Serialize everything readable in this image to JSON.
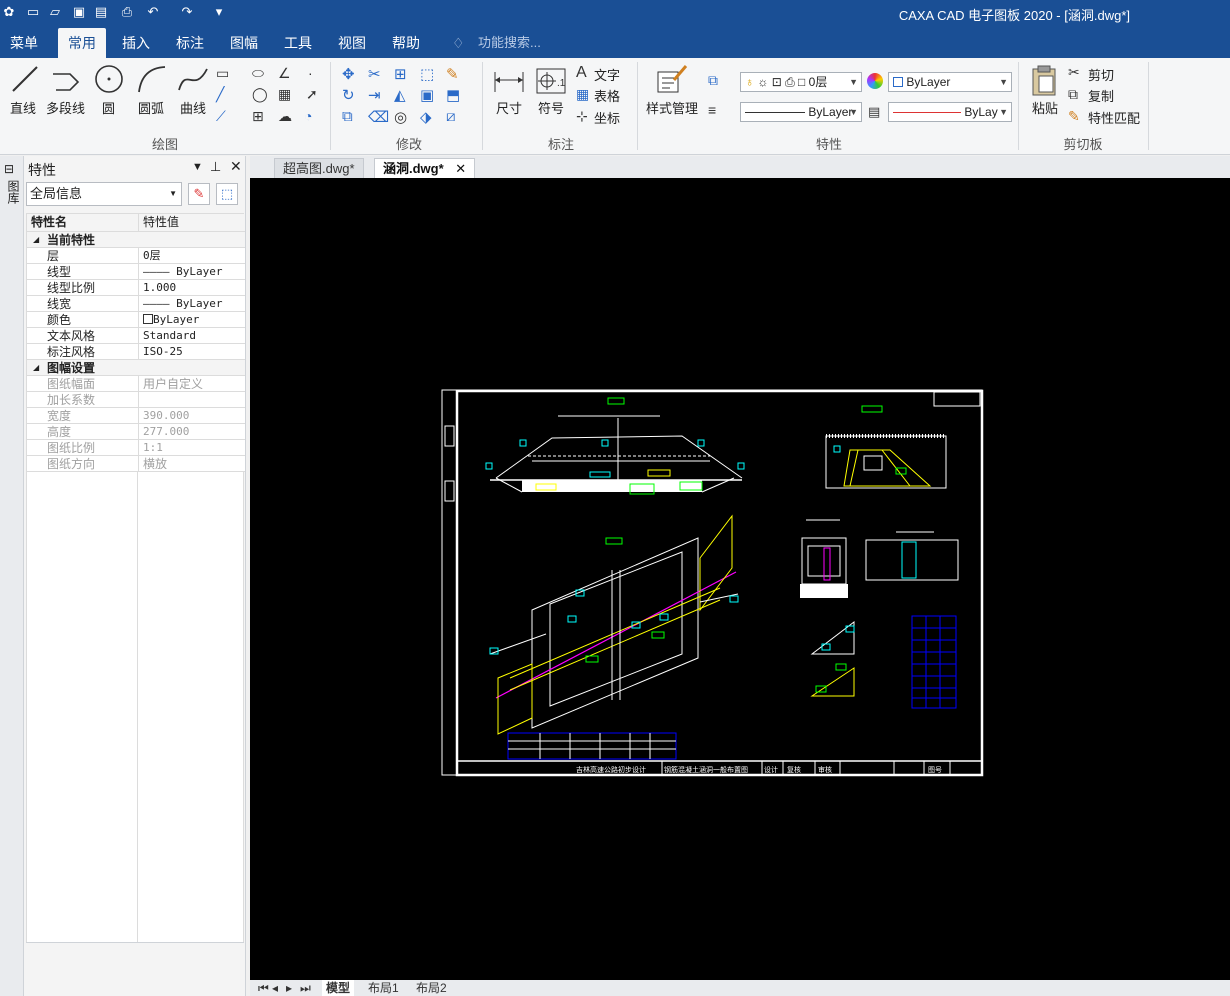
{
  "app_title": "CAXA CAD 电子图板 2020 - [涵洞.dwg*]",
  "quick_access": [
    "app-logo-icon",
    "new-icon",
    "open-icon",
    "save-icon",
    "save-all-icon",
    "print-icon",
    "undo-icon",
    "redo-icon",
    "customize-icon"
  ],
  "menubar": {
    "tabs": [
      "菜单",
      "常用",
      "插入",
      "标注",
      "图幅",
      "工具",
      "视图",
      "帮助"
    ],
    "active": "常用",
    "search_placeholder": "功能搜索..."
  },
  "ribbon": {
    "draw": {
      "line": "直线",
      "polyline": "多段线",
      "circle": "圆",
      "arc": "圆弧",
      "curve": "曲线",
      "group": "绘图"
    },
    "modify": {
      "group": "修改"
    },
    "annotate": {
      "dimension": "尺寸",
      "symbol": "符号",
      "text": "文字",
      "table": "表格",
      "coordinate": "坐标",
      "group": "标注"
    },
    "properties": {
      "style_manage": "样式管理",
      "layer": "0层",
      "color_value": "ByLayer",
      "linetype_value": "ByLayer",
      "lineweight_value": "ByLay",
      "group": "特性"
    },
    "clipboard": {
      "paste": "粘贴",
      "cut": "剪切",
      "copy": "复制",
      "match": "特性匹配",
      "group": "剪切板"
    }
  },
  "left_strip": {
    "label": "图库"
  },
  "panel": {
    "title": "特性",
    "selector": "全局信息",
    "col_name": "特性名",
    "col_value": "特性值",
    "sections": [
      {
        "title": "当前特性",
        "rows": [
          {
            "name": "层",
            "value": "0层"
          },
          {
            "name": "线型",
            "value": "———— ByLayer"
          },
          {
            "name": "线型比例",
            "value": "1.000"
          },
          {
            "name": "线宽",
            "value": "———— ByLayer"
          },
          {
            "name": "颜色",
            "value": "ByLayer"
          },
          {
            "name": "文本风格",
            "value": "Standard"
          },
          {
            "name": "标注风格",
            "value": "ISO-25"
          }
        ]
      },
      {
        "title": "图幅设置",
        "rows": [
          {
            "name": "图纸幅面",
            "value": "用户自定义"
          },
          {
            "name": "加长系数",
            "value": ""
          },
          {
            "name": "宽度",
            "value": "390.000"
          },
          {
            "name": "高度",
            "value": "277.000"
          },
          {
            "name": "图纸比例",
            "value": "1:1"
          },
          {
            "name": "图纸方向",
            "value": "横放"
          }
        ]
      }
    ]
  },
  "doc_tabs": [
    {
      "label": "超高图.dwg*",
      "active": false
    },
    {
      "label": "涵洞.dwg*",
      "active": true
    }
  ],
  "layout_tabs": [
    "模型",
    "布局1",
    "布局2"
  ],
  "active_layout": "模型",
  "drawing": {
    "title_block": [
      "吉林高速公路初步设计",
      "钢筋混凝土涵洞一般布置图",
      "设计",
      "复核",
      "审核",
      "图号"
    ]
  },
  "colors": {
    "title_bar": "#1a4f95",
    "canvas": "#000000",
    "cad_yellow": "#ffff00",
    "cad_cyan": "#00ffff",
    "cad_green": "#00ff00",
    "cad_magenta": "#ff00ff",
    "cad_blue": "#3050ff"
  }
}
